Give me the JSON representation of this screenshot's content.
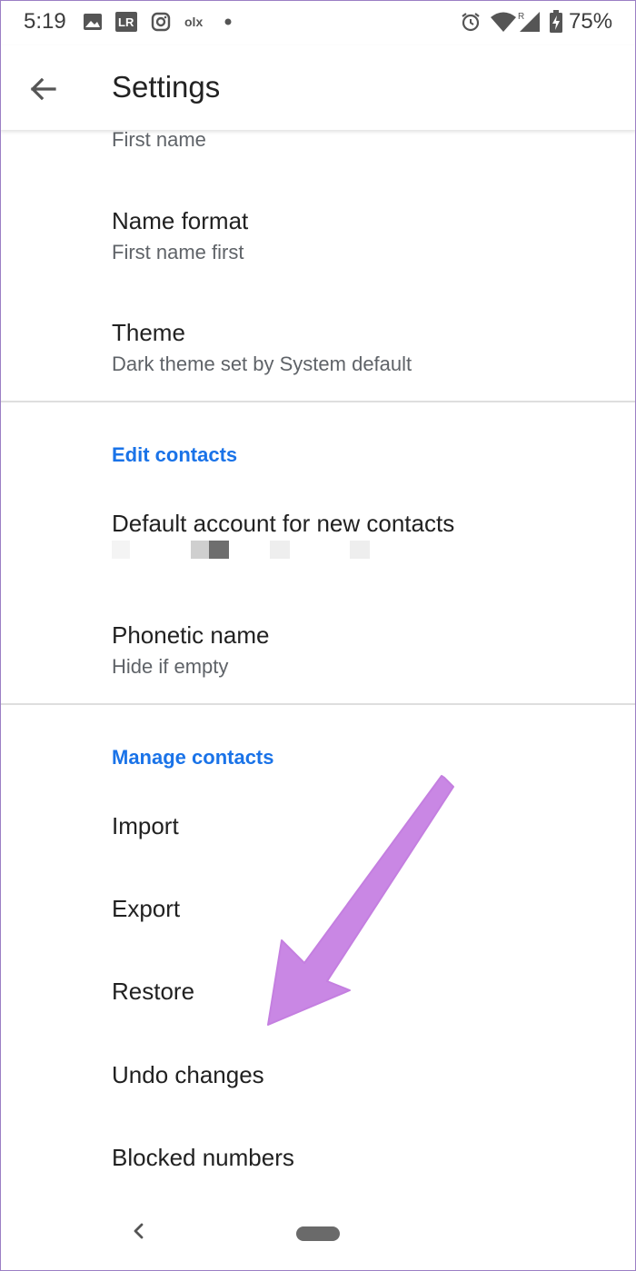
{
  "status_bar": {
    "time": "5:19",
    "battery_percent": "75%",
    "icons": [
      "image-icon",
      "lr-app-icon",
      "instagram-icon",
      "olx-icon",
      "notification-dot-icon",
      "alarm-icon",
      "wifi-icon",
      "signal-icon",
      "battery-charging-icon"
    ],
    "lr_label": "LR",
    "olx_label": "olx",
    "roaming_label": "R"
  },
  "app_bar": {
    "title": "Settings",
    "back_icon": "arrow-back-icon"
  },
  "settings": {
    "first_name_sub": "First name",
    "name_format": {
      "title": "Name format",
      "sub": "First name first"
    },
    "theme": {
      "title": "Theme",
      "sub": "Dark theme set by System default"
    },
    "edit_contacts_header": "Edit contacts",
    "default_account": {
      "title": "Default account for new contacts"
    },
    "phonetic_name": {
      "title": "Phonetic name",
      "sub": "Hide if empty"
    },
    "manage_contacts_header": "Manage contacts",
    "import": "Import",
    "export": "Export",
    "restore": "Restore",
    "undo_changes": "Undo changes",
    "blocked_numbers": "Blocked numbers"
  },
  "annotation": {
    "arrow_color": "#c987e4",
    "arrow_icon": "pointer-arrow-icon"
  },
  "colors": {
    "accent": "#1a73e8",
    "primary_text": "#212121",
    "secondary_text": "#5f6368",
    "divider": "#dedede"
  },
  "nav_bar": {
    "back_icon": "nav-back-icon",
    "home_icon": "home-pill-icon"
  }
}
